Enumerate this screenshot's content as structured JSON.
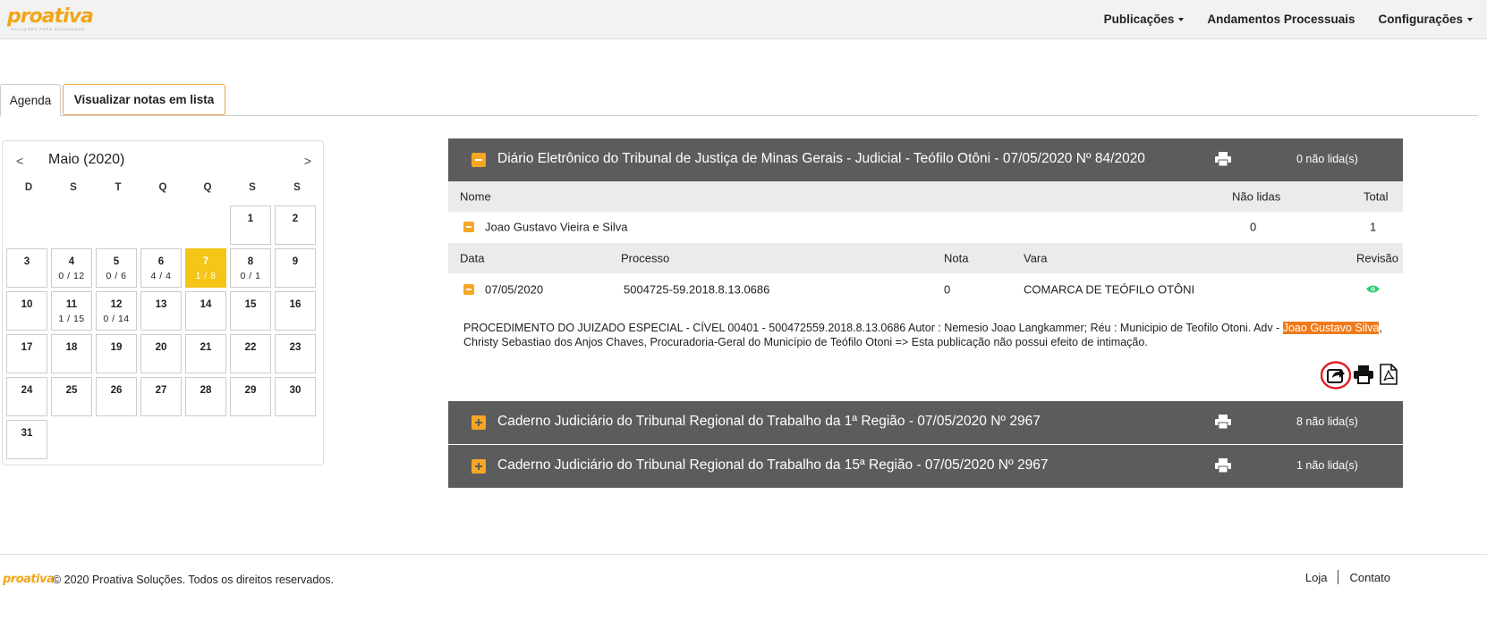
{
  "brand": {
    "name": "proativa",
    "tagline": "SOLUÇÕES PARA ADVOGADOS",
    "accent": "#f2a516"
  },
  "nav": {
    "publicacoes": "Publicações",
    "andamentos": "Andamentos Processuais",
    "configuracoes": "Configurações"
  },
  "tabs": {
    "agenda": "Agenda",
    "lista": "Visualizar notas em lista"
  },
  "calendar": {
    "prev": "<",
    "next": ">",
    "title": "Maio (2020)",
    "weekdays": [
      "D",
      "S",
      "T",
      "Q",
      "Q",
      "S",
      "S"
    ],
    "selected_day": "7",
    "days": [
      {
        "n": "",
        "c": ""
      },
      {
        "n": "",
        "c": ""
      },
      {
        "n": "",
        "c": ""
      },
      {
        "n": "",
        "c": ""
      },
      {
        "n": "",
        "c": ""
      },
      {
        "n": "1",
        "c": ""
      },
      {
        "n": "2",
        "c": ""
      },
      {
        "n": "3",
        "c": ""
      },
      {
        "n": "4",
        "c": "0 / 12"
      },
      {
        "n": "5",
        "c": "0 / 6"
      },
      {
        "n": "6",
        "c": "4 / 4"
      },
      {
        "n": "7",
        "c": "1 / 8"
      },
      {
        "n": "8",
        "c": "0 / 1"
      },
      {
        "n": "9",
        "c": ""
      },
      {
        "n": "10",
        "c": ""
      },
      {
        "n": "11",
        "c": "1 / 15"
      },
      {
        "n": "12",
        "c": "0 / 14"
      },
      {
        "n": "13",
        "c": ""
      },
      {
        "n": "14",
        "c": ""
      },
      {
        "n": "15",
        "c": ""
      },
      {
        "n": "16",
        "c": ""
      },
      {
        "n": "17",
        "c": ""
      },
      {
        "n": "18",
        "c": ""
      },
      {
        "n": "19",
        "c": ""
      },
      {
        "n": "20",
        "c": ""
      },
      {
        "n": "21",
        "c": ""
      },
      {
        "n": "22",
        "c": ""
      },
      {
        "n": "23",
        "c": ""
      },
      {
        "n": "24",
        "c": ""
      },
      {
        "n": "25",
        "c": ""
      },
      {
        "n": "26",
        "c": ""
      },
      {
        "n": "27",
        "c": ""
      },
      {
        "n": "28",
        "c": ""
      },
      {
        "n": "29",
        "c": ""
      },
      {
        "n": "30",
        "c": ""
      },
      {
        "n": "31",
        "c": ""
      }
    ]
  },
  "panels": [
    {
      "title": "Diário Eletrônico do Tribunal de Justiça de Minas Gerais - Judicial - Teófilo Otôni - 07/05/2020 Nº 84/2020",
      "unread": "0 não lida(s)",
      "expanded": true
    },
    {
      "title": "Caderno Judiciário do Tribunal Regional do Trabalho da 1ª Região - 07/05/2020 Nº 2967",
      "unread": "8 não lida(s)",
      "expanded": false
    },
    {
      "title": "Caderno Judiciário do Tribunal Regional do Trabalho da 15ª Região - 07/05/2020 Nº 2967",
      "unread": "1 não lida(s)",
      "expanded": false
    }
  ],
  "names_table": {
    "headers": {
      "nome": "Nome",
      "nao_lidas": "Não lidas",
      "total": "Total"
    },
    "row": {
      "nome": "Joao Gustavo Vieira e Silva",
      "nao_lidas": "0",
      "total": "1"
    }
  },
  "pub_table": {
    "headers": {
      "data": "Data",
      "processo": "Processo",
      "nota": "Nota",
      "vara": "Vara",
      "revisao": "Revisão"
    },
    "row": {
      "data": "07/05/2020",
      "processo": "5004725-59.2018.8.13.0686",
      "nota": "0",
      "vara": "COMARCA DE TEÓFILO OTÔNI"
    }
  },
  "publication": {
    "before": "PROCEDIMENTO DO JUIZADO ESPECIAL - CÍVEL 00401 - 500472559.2018.8.13.0686 Autor : Nemesio Joao Langkammer; Réu : Municipio de Teofilo Otoni. Adv - ",
    "highlight": "Joao Gustavo Silva",
    "after": ", Christy Sebastiao dos Anjos Chaves, Procuradoria-Geral do Município de Teófilo Otoni => Esta publicação não possui efeito de intimação."
  },
  "footer": {
    "logo": "proativa",
    "copyright": "© 2020 Proativa Soluções. Todos os direitos reservados.",
    "loja": "Loja",
    "contato": "Contato"
  }
}
